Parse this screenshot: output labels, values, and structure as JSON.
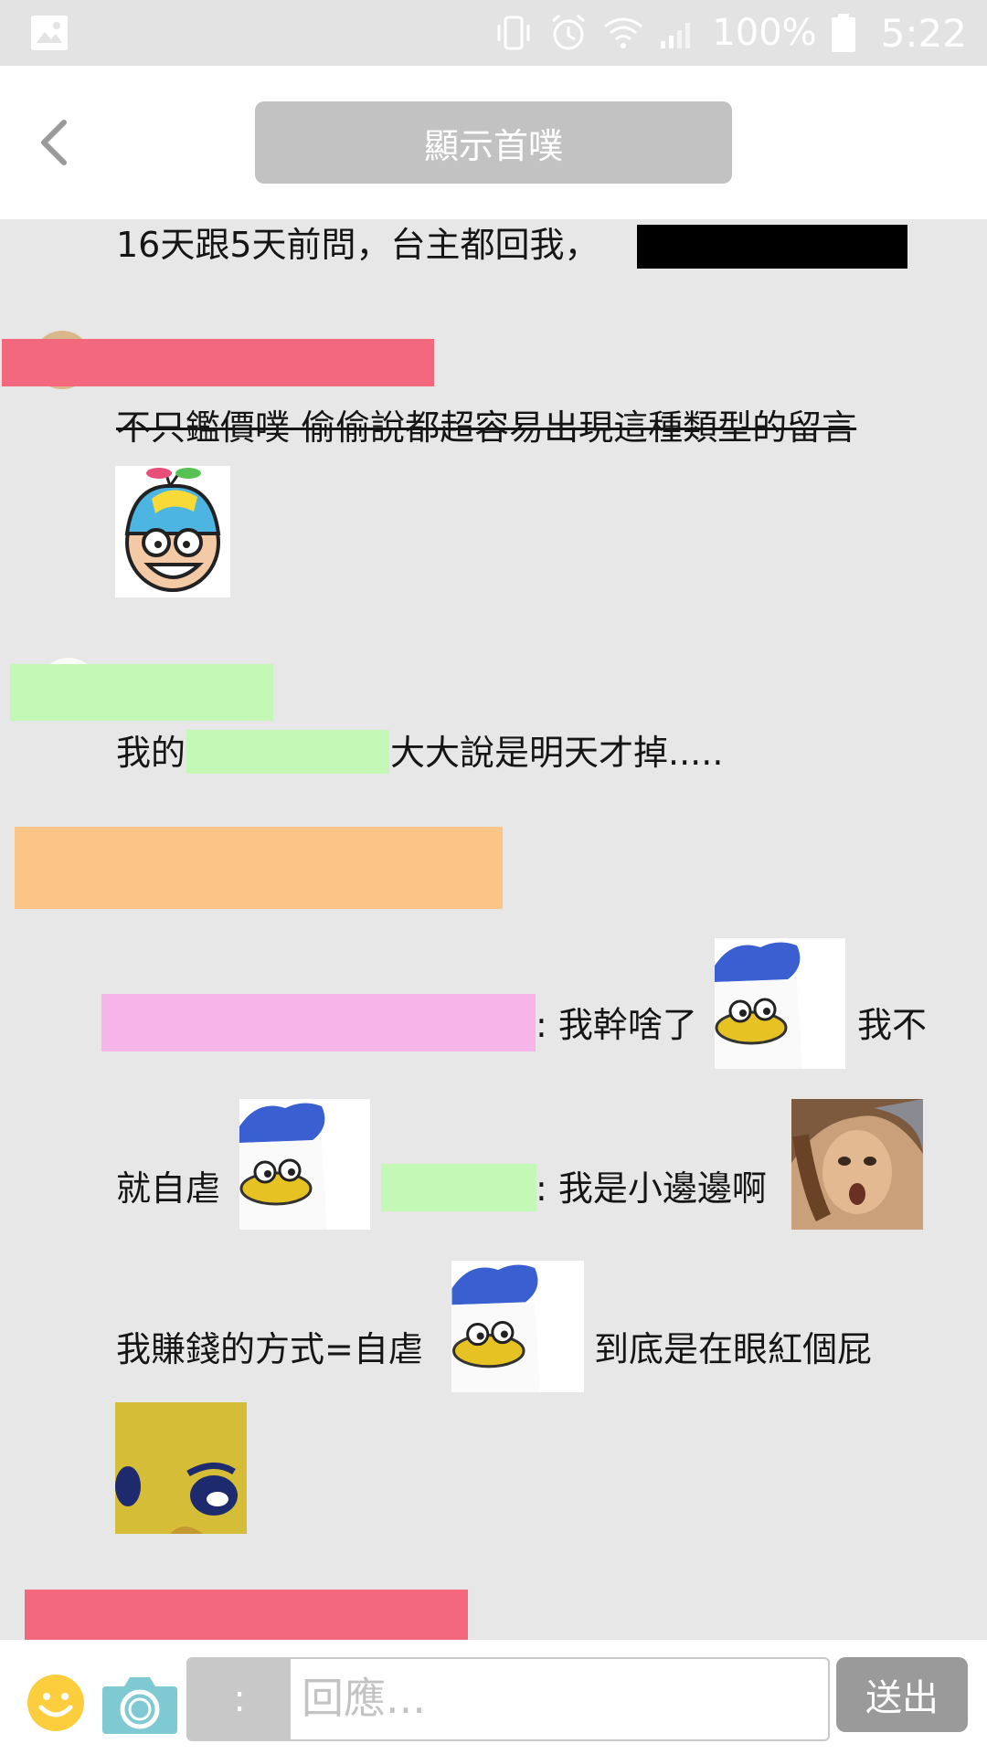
{
  "status_bar": {
    "battery_percent": "100%",
    "time": "5:22",
    "icons": [
      "gallery-icon",
      "vibrate-icon",
      "alarm-icon",
      "wifi-icon",
      "signal-icon",
      "battery-icon"
    ]
  },
  "header": {
    "show_first_plurk_label": "顯示首噗",
    "back_icon": "chevron-left-icon"
  },
  "feed": {
    "line_1": "16天跟5天前問，台主都回我，",
    "line_2_struck": "不只鑑價噗 偷偷說都超容易出現這種類型的留言",
    "line_3_prefix": "我的",
    "line_3_suffix": "大大說是明天才掉.....",
    "line_4_mid": ": 我幹啥了",
    "line_4_end": "我不",
    "line_5_prefix": "就自虐",
    "line_5_mid": ": 我是小邊邊啊",
    "line_6_prefix": "我賺錢的方式=自虐",
    "line_6_suffix": "到底是在眼紅個屁"
  },
  "bottom_bar": {
    "qualifier_label": ":",
    "reply_placeholder": "回應...",
    "send_label": "送出"
  },
  "colors": {
    "background": "#e7e7e8",
    "redact_red": "#f4687e",
    "redact_green": "#c4f8b6",
    "redact_orange": "#fcc487",
    "redact_pink": "#f6b4e8",
    "redact_black": "#000000",
    "send_button": "#9a9a9a",
    "camera_icon": "#7fc9d3",
    "emoji_icon": "#fccd3c"
  }
}
